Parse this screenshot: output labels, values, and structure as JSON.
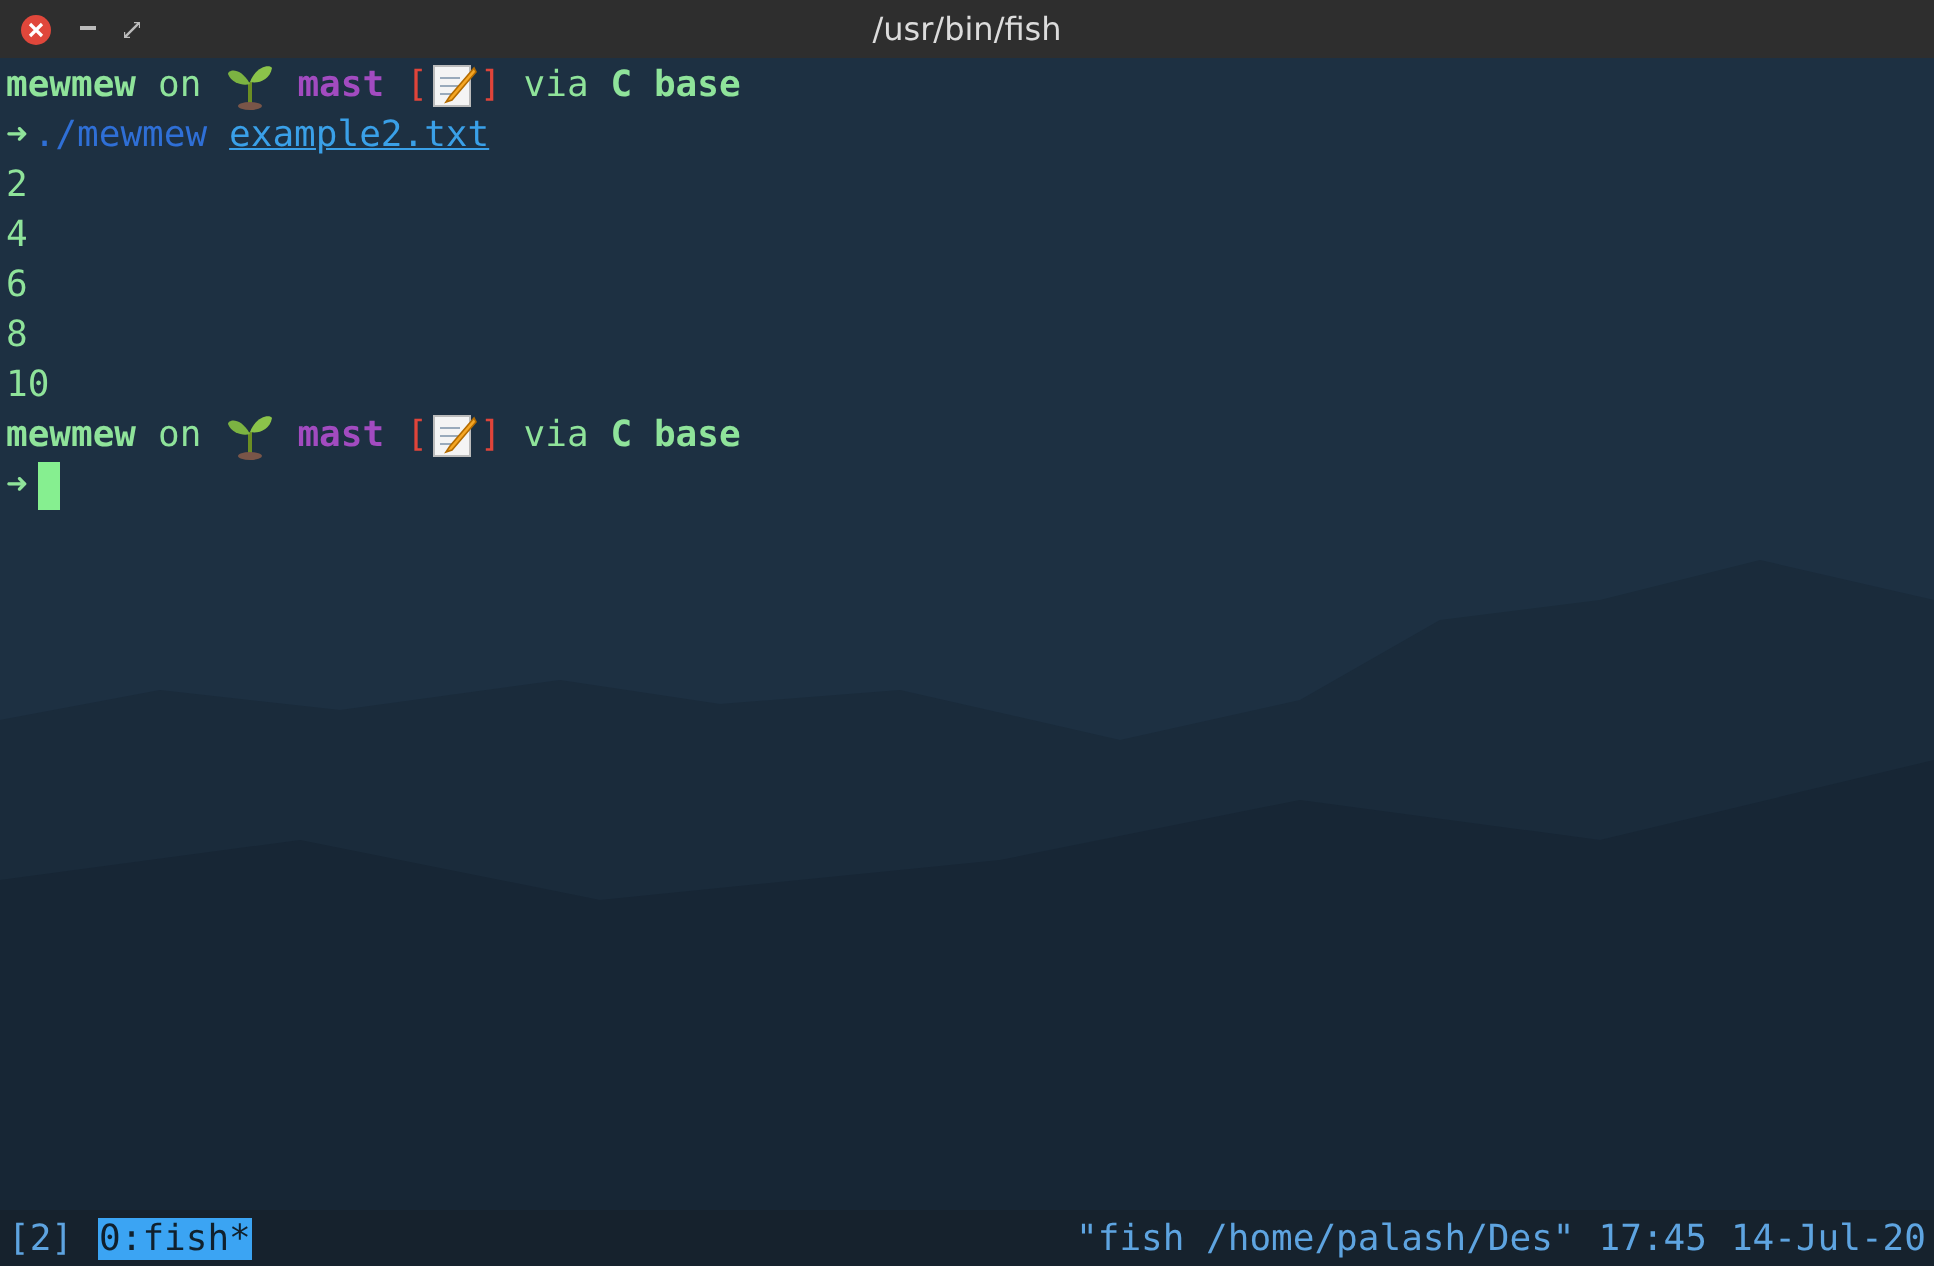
{
  "window": {
    "title": "/usr/bin/fish"
  },
  "lines": [
    {
      "kind": "prompt",
      "segments": [
        {
          "kind": "bold",
          "text": "mewmew"
        },
        {
          "kind": "plain",
          "text": "on"
        },
        {
          "kind": "sprout"
        },
        {
          "kind": "branch",
          "text": "mast"
        },
        {
          "kind": "bracket",
          "text": "["
        },
        {
          "kind": "memo"
        },
        {
          "kind": "bracket",
          "text": "]"
        },
        {
          "kind": "plain",
          "text": "via"
        },
        {
          "kind": "bold",
          "text": "C base"
        }
      ]
    },
    {
      "kind": "command",
      "arrow": "➜",
      "command": "./mewmew",
      "argument": "example2.txt"
    },
    {
      "kind": "output",
      "text": "2"
    },
    {
      "kind": "output",
      "text": "4"
    },
    {
      "kind": "output",
      "text": "6"
    },
    {
      "kind": "output",
      "text": "8"
    },
    {
      "kind": "output",
      "text": "10"
    },
    {
      "kind": "prompt",
      "segments": [
        {
          "kind": "bold",
          "text": "mewmew"
        },
        {
          "kind": "plain",
          "text": "on"
        },
        {
          "kind": "sprout"
        },
        {
          "kind": "branch",
          "text": "mast"
        },
        {
          "kind": "bracket",
          "text": "["
        },
        {
          "kind": "memo"
        },
        {
          "kind": "bracket",
          "text": "]"
        },
        {
          "kind": "plain",
          "text": "via"
        },
        {
          "kind": "bold",
          "text": "C base"
        }
      ]
    },
    {
      "kind": "input",
      "arrow": "➜"
    }
  ],
  "status_bar": {
    "session": "[2]",
    "windows": [
      {
        "label": "0:fish*",
        "selected": true
      }
    ],
    "pane_title": "\"fish /home/palash/Des\"",
    "time": "17:45",
    "date": "14-Jul-20"
  }
}
